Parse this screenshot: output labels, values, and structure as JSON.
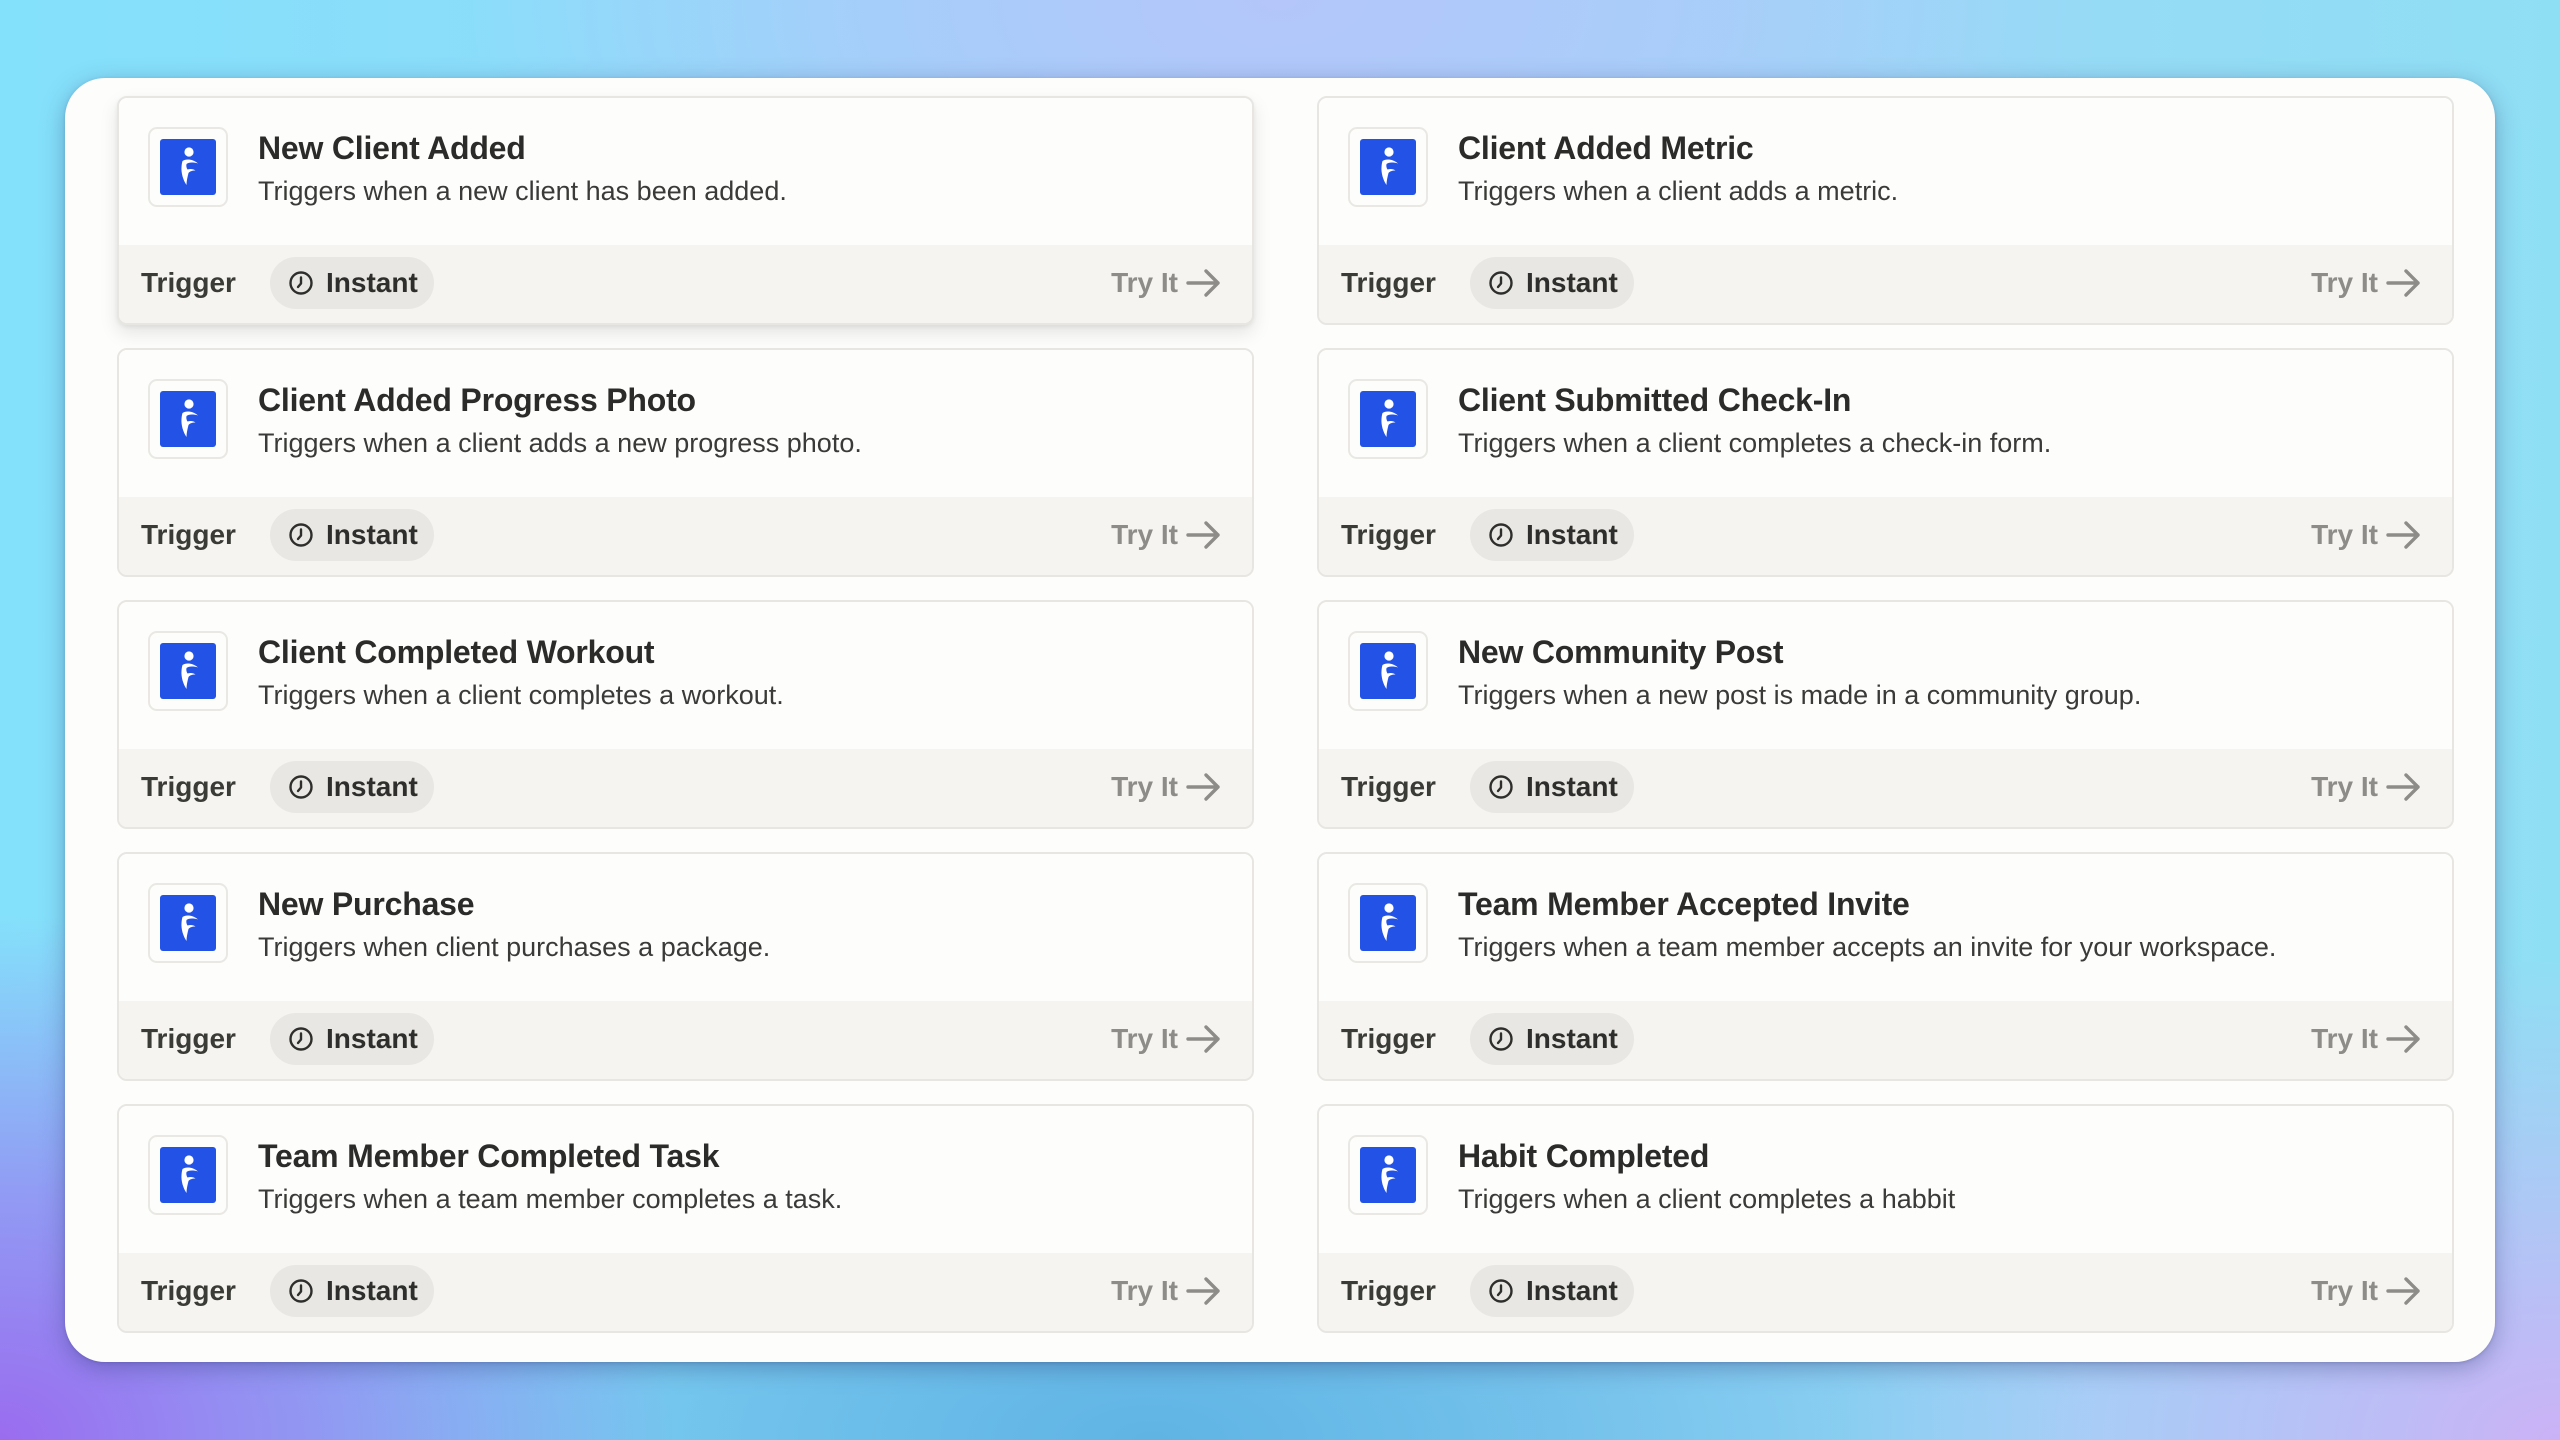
{
  "colors": {
    "brand": "#2253e6",
    "title_text": "#2b2b29",
    "description_text": "#3a3a38",
    "muted_link": "#8e8c88",
    "pill_bg": "#e8e7e3",
    "footer_bg": "#f5f4f1"
  },
  "cards": [
    {
      "title": "New Client Added",
      "description": "Triggers when a new client has been added.",
      "type_label": "Trigger",
      "badge_icon": "clock-icon",
      "badge_label": "Instant",
      "action_label": "Try It",
      "action_icon": "arrow-right-icon",
      "app_icon": "fitness-app-logo-icon"
    },
    {
      "title": "Client Added Metric",
      "description": "Triggers when a client adds a metric.",
      "type_label": "Trigger",
      "badge_icon": "clock-icon",
      "badge_label": "Instant",
      "action_label": "Try It",
      "action_icon": "arrow-right-icon",
      "app_icon": "fitness-app-logo-icon"
    },
    {
      "title": "Client Added Progress Photo",
      "description": "Triggers when a client adds a new progress photo.",
      "type_label": "Trigger",
      "badge_icon": "clock-icon",
      "badge_label": "Instant",
      "action_label": "Try It",
      "action_icon": "arrow-right-icon",
      "app_icon": "fitness-app-logo-icon"
    },
    {
      "title": "Client Submitted Check-In",
      "description": "Triggers when a client completes a check-in form.",
      "type_label": "Trigger",
      "badge_icon": "clock-icon",
      "badge_label": "Instant",
      "action_label": "Try It",
      "action_icon": "arrow-right-icon",
      "app_icon": "fitness-app-logo-icon"
    },
    {
      "title": "Client Completed Workout",
      "description": "Triggers when a client completes a workout.",
      "type_label": "Trigger",
      "badge_icon": "clock-icon",
      "badge_label": "Instant",
      "action_label": "Try It",
      "action_icon": "arrow-right-icon",
      "app_icon": "fitness-app-logo-icon"
    },
    {
      "title": "New Community Post",
      "description": "Triggers when a new post is made in a community group.",
      "type_label": "Trigger",
      "badge_icon": "clock-icon",
      "badge_label": "Instant",
      "action_label": "Try It",
      "action_icon": "arrow-right-icon",
      "app_icon": "fitness-app-logo-icon"
    },
    {
      "title": "New Purchase",
      "description": "Triggers when client purchases a package.",
      "type_label": "Trigger",
      "badge_icon": "clock-icon",
      "badge_label": "Instant",
      "action_label": "Try It",
      "action_icon": "arrow-right-icon",
      "app_icon": "fitness-app-logo-icon"
    },
    {
      "title": "Team Member Accepted Invite",
      "description": "Triggers when a team member accepts an invite for your workspace.",
      "type_label": "Trigger",
      "badge_icon": "clock-icon",
      "badge_label": "Instant",
      "action_label": "Try It",
      "action_icon": "arrow-right-icon",
      "app_icon": "fitness-app-logo-icon"
    },
    {
      "title": "Team Member Completed Task",
      "description": "Triggers when a team member completes a task.",
      "type_label": "Trigger",
      "badge_icon": "clock-icon",
      "badge_label": "Instant",
      "action_label": "Try It",
      "action_icon": "arrow-right-icon",
      "app_icon": "fitness-app-logo-icon"
    },
    {
      "title": "Habit Completed",
      "description": "Triggers when a client completes a habbit",
      "type_label": "Trigger",
      "badge_icon": "clock-icon",
      "badge_label": "Instant",
      "action_label": "Try It",
      "action_icon": "arrow-right-icon",
      "app_icon": "fitness-app-logo-icon"
    }
  ]
}
